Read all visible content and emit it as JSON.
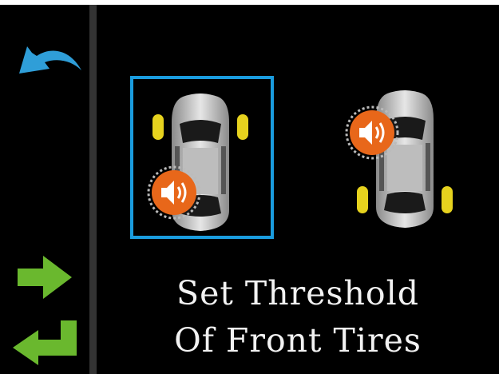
{
  "screen": {
    "title_line1": "Set Threshold",
    "title_line2": "Of Front Tires"
  },
  "sidebar": {
    "buttons": [
      {
        "name": "back",
        "icon": "curved-back-arrow-icon",
        "color": "#2f9ed8"
      },
      {
        "name": "next",
        "icon": "right-arrow-icon",
        "color": "#6ab82e"
      },
      {
        "name": "enter",
        "icon": "enter-return-arrow-icon",
        "color": "#6ab82e"
      }
    ]
  },
  "options": [
    {
      "id": "front-tires",
      "selected": true,
      "highlight_color": "#1a9cde",
      "highlighted_tires": "front"
    },
    {
      "id": "rear-tires",
      "selected": false,
      "highlighted_tires": "rear"
    }
  ],
  "colors": {
    "background": "#000000",
    "tire_highlight": "#e6d21e",
    "alarm_badge": "#e8671a"
  }
}
